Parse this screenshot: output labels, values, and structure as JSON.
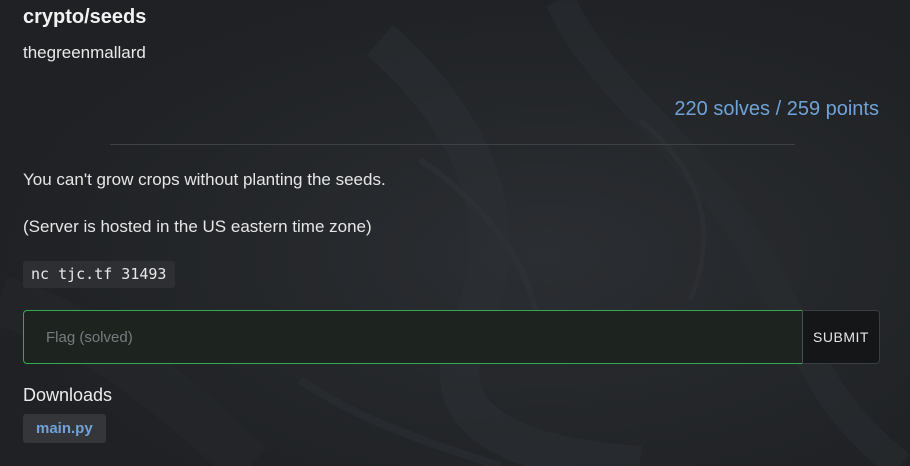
{
  "challenge": {
    "title": "crypto/seeds",
    "author": "thegreenmallard",
    "stats": "220 solves / 259 points",
    "description": [
      "You can't grow crops without planting the seeds.",
      "(Server is hosted in the US eastern time zone)"
    ],
    "connection": "nc tjc.tf 31493"
  },
  "flag_form": {
    "placeholder": "Flag (solved)",
    "value": "",
    "submit_label": "SUBMIT",
    "border_color": "#34a853"
  },
  "downloads": {
    "title": "Downloads",
    "files": [
      "main.py"
    ]
  },
  "colors": {
    "accent": "#6fa3d8",
    "background": "#222427"
  }
}
